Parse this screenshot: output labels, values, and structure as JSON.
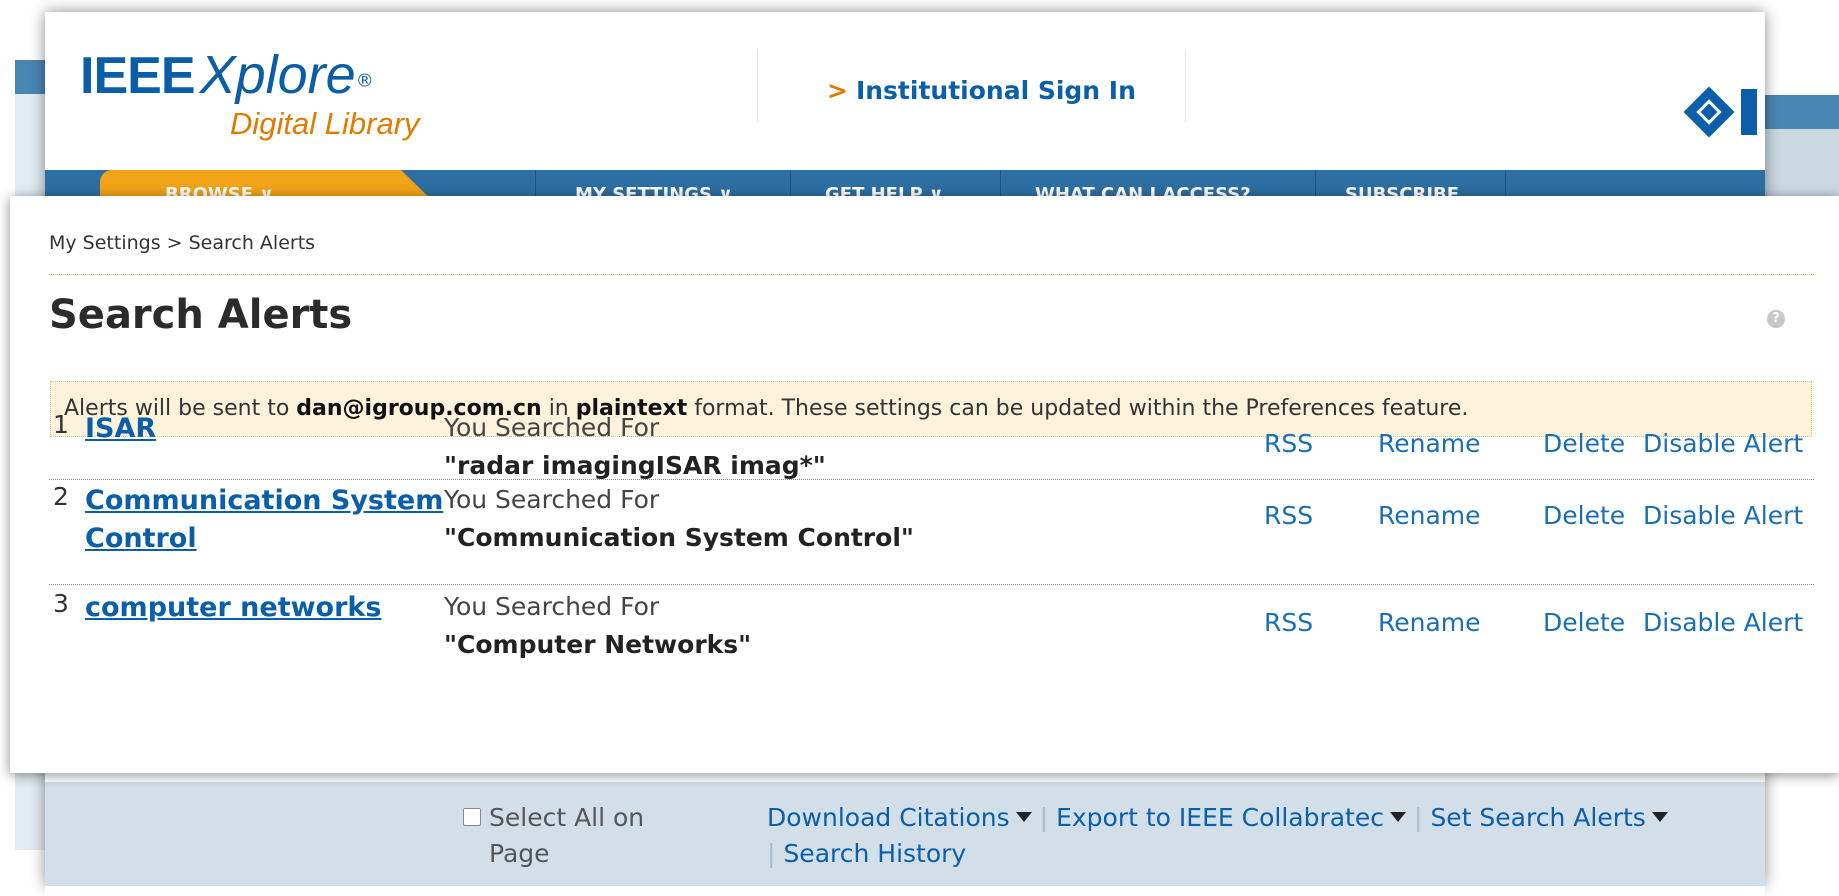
{
  "logo": {
    "ieee": "IEEE",
    "xplore": "Xplore",
    "registered": "®",
    "tagline": "Digital Library"
  },
  "header": {
    "signin_chevron": ">",
    "signin_label": "Institutional Sign In"
  },
  "nav": {
    "items": [
      "BROWSE ∨",
      "MY SETTINGS ∨",
      "GET HELP ∨",
      "WHAT CAN I ACCESS?",
      "SUBSCRIBE"
    ]
  },
  "breadcrumb": "My Settings > Search Alerts",
  "page_title": "Search Alerts",
  "help_icon": "?",
  "notice": {
    "prefix": "Alerts will be sent to ",
    "email": "dan@igroup.com.cn",
    "middle": " in ",
    "format": "plaintext",
    "suffix": " format. These settings can be updated within the Preferences feature."
  },
  "alerts": [
    {
      "num": "1",
      "name": "ISAR",
      "label": "You Searched For",
      "query": "\"radar imagingISAR imag*\""
    },
    {
      "num": "2",
      "name": "Communication System Control",
      "label": "You Searched For",
      "query": "\"Communication System Control\""
    },
    {
      "num": "3",
      "name": "computer networks",
      "label": "You Searched For",
      "query": "\"Computer Networks\""
    }
  ],
  "actions": {
    "rss": "RSS",
    "rename": "Rename",
    "delete": "Delete",
    "disable": "Disable Alert"
  },
  "bottom_bar": {
    "select_all": "Select All on Page",
    "download": "Download Citations",
    "export": "Export to IEEE Collabratec",
    "set_alerts": "Set Search Alerts",
    "history": "Search History",
    "separator": "|"
  },
  "colors": {
    "brand_blue": "#0a5ea7",
    "brand_orange": "#e07b00",
    "nav_blue": "#2d6fa3",
    "browse_orange": "#f2a419",
    "notice_bg": "#fdf3dc",
    "link_blue": "#1a6fb4"
  }
}
